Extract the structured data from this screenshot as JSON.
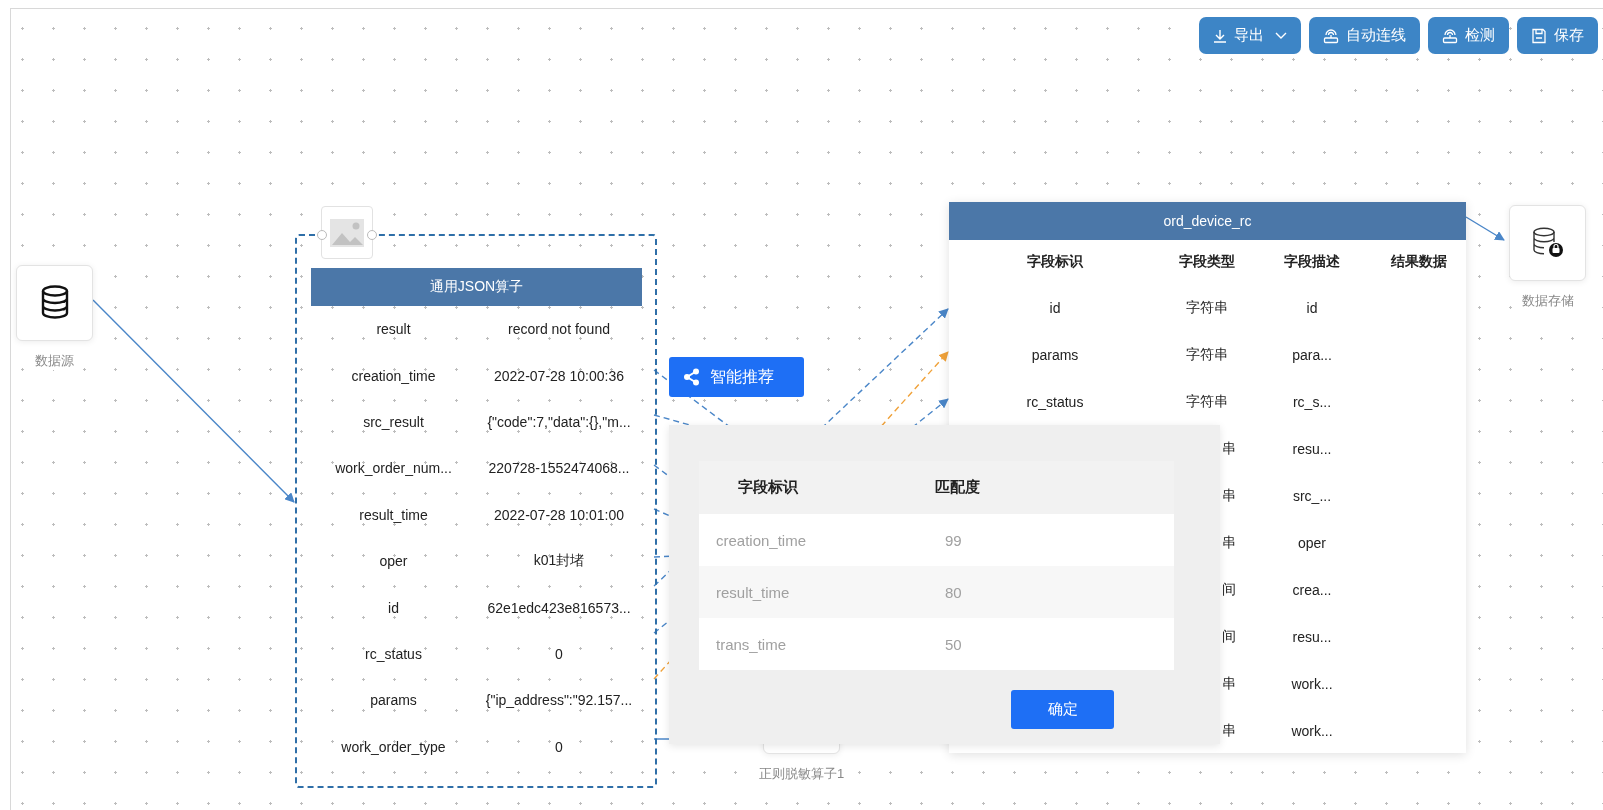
{
  "toolbar": [
    {
      "label": "导出",
      "kind": "export",
      "dropdown": true
    },
    {
      "label": "自动连线",
      "kind": "connect",
      "dropdown": false
    },
    {
      "label": "检测",
      "kind": "check",
      "dropdown": false
    },
    {
      "label": "保存",
      "kind": "save",
      "dropdown": false
    }
  ],
  "source_node": {
    "label": "数据源"
  },
  "json_operator": {
    "title": "通用JSON算子",
    "rows": [
      {
        "key": "result",
        "value": "record not found"
      },
      {
        "key": "creation_time",
        "value": "2022-07-28 10:00:36"
      },
      {
        "key": "src_result",
        "value": "{\"code\":7,\"data\":{},\"m..."
      },
      {
        "key": "work_order_num...",
        "value": "220728-1552474068..."
      },
      {
        "key": "result_time",
        "value": "2022-07-28 10:01:00"
      },
      {
        "key": "oper",
        "value": "k01封堵"
      },
      {
        "key": "id",
        "value": "62e1edc423e816573..."
      },
      {
        "key": "rc_status",
        "value": "0"
      },
      {
        "key": "params",
        "value": "{\"ip_address\":\"92.157..."
      },
      {
        "key": "work_order_type",
        "value": "0"
      }
    ]
  },
  "recommend_button": {
    "label": "智能推荐"
  },
  "target_table": {
    "title": "ord_device_rc",
    "columns": [
      "字段标识",
      "字段类型",
      "字段描述",
      "结果数据"
    ],
    "rows": [
      {
        "kind": "full",
        "field": "id",
        "type": "字符串",
        "desc": "id"
      },
      {
        "kind": "full",
        "field": "params",
        "type": "字符串",
        "desc": "para..."
      },
      {
        "kind": "full",
        "field": "rc_status",
        "type": "字符串",
        "desc": "rc_s..."
      },
      {
        "kind": "covered",
        "type": "串",
        "desc": "resu..."
      },
      {
        "kind": "covered",
        "type": "串",
        "desc": "src_..."
      },
      {
        "kind": "covered",
        "type": "串",
        "desc": "oper"
      },
      {
        "kind": "covered",
        "type": "间",
        "desc": "crea..."
      },
      {
        "kind": "covered",
        "type": "间",
        "desc": "resu..."
      },
      {
        "kind": "covered",
        "type": "串",
        "desc": "work..."
      },
      {
        "kind": "covered",
        "type": "串",
        "desc": "work..."
      }
    ]
  },
  "storage_node": {
    "label": "数据存储"
  },
  "regex_node": {
    "label": "正则脱敏算子1"
  },
  "match_dialog": {
    "columns": [
      "字段标识",
      "匹配度"
    ],
    "rows": [
      {
        "field": "creation_time",
        "score": "99"
      },
      {
        "field": "result_time",
        "score": "80"
      },
      {
        "field": "trans_time",
        "score": "50"
      }
    ],
    "confirm": "确定"
  }
}
